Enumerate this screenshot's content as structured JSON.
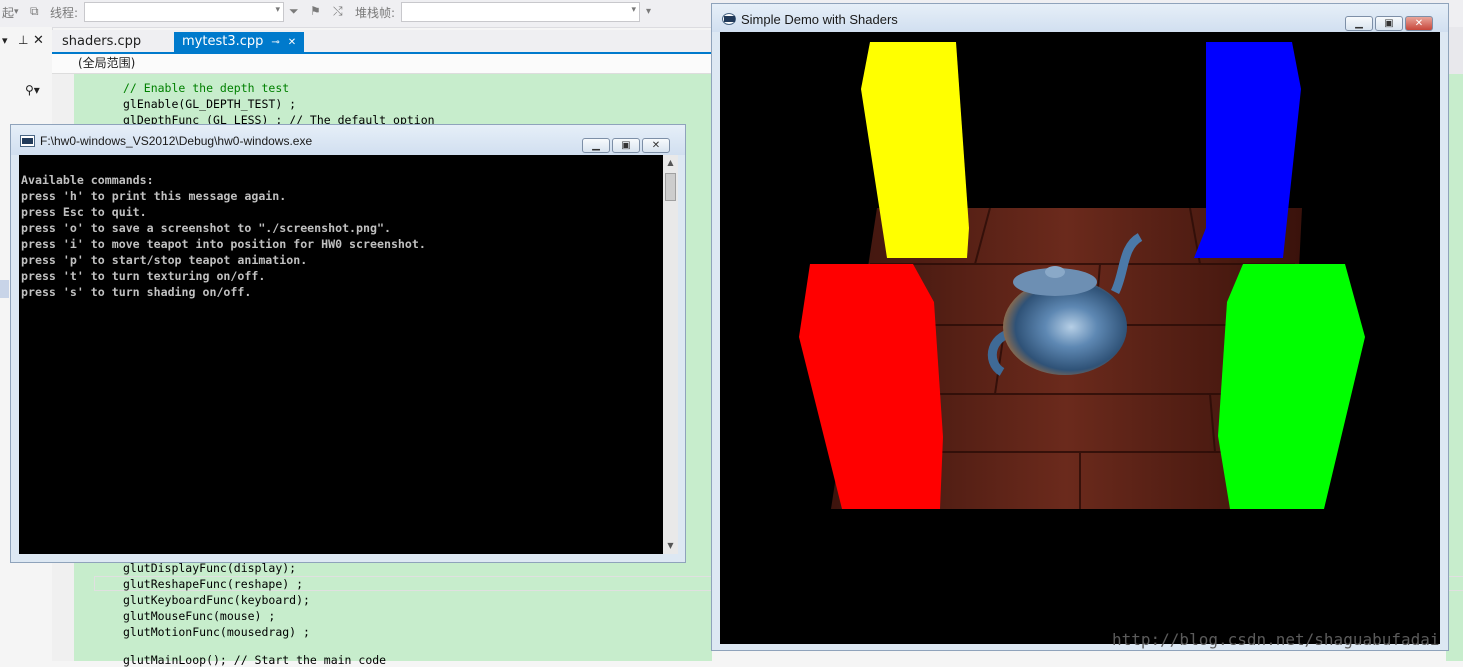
{
  "ide": {
    "toolbar": {
      "item1": "起",
      "thread_label": "线程:",
      "stackframe_label": "堆栈帧:"
    },
    "tabs": [
      {
        "label": "shaders.cpp"
      },
      {
        "label": "mytest3.cpp"
      }
    ],
    "scope": "(全局范围)",
    "code_lines_top": [
      "// Enable the depth test",
      "glEnable(GL_DEPTH_TEST) ;",
      "glDepthFunc (GL_LESS) ; // The default option"
    ],
    "code_lines_bottom": [
      "glutDisplayFunc(display);",
      "glutReshapeFunc(reshape) ;",
      "glutKeyboardFunc(keyboard);",
      "glutMouseFunc(mouse) ;",
      "glutMotionFunc(mousedrag) ;",
      "glutMainLoop(); // Start the main code"
    ]
  },
  "console": {
    "title": "F:\\hw0-windows_VS2012\\Debug\\hw0-windows.exe",
    "lines": [
      "Available commands:",
      "press 'h' to print this message again.",
      "press Esc to quit.",
      "press 'o' to save a screenshot to \"./screenshot.png\".",
      "press 'i' to move teapot into position for HW0 screenshot.",
      "press 'p' to start/stop teapot animation.",
      "press 't' to turn texturing on/off.",
      "press 's' to turn shading on/off."
    ]
  },
  "glwindow": {
    "title": "Simple Demo with Shaders",
    "colors": {
      "yellow": "#ffff00",
      "blue": "#0000ff",
      "red": "#ff0000",
      "green": "#00ff00",
      "floor": "#5a2116",
      "teapot": "#4f7fb0"
    }
  },
  "watermark": "http://blog.csdn.net/shaguabufadai"
}
